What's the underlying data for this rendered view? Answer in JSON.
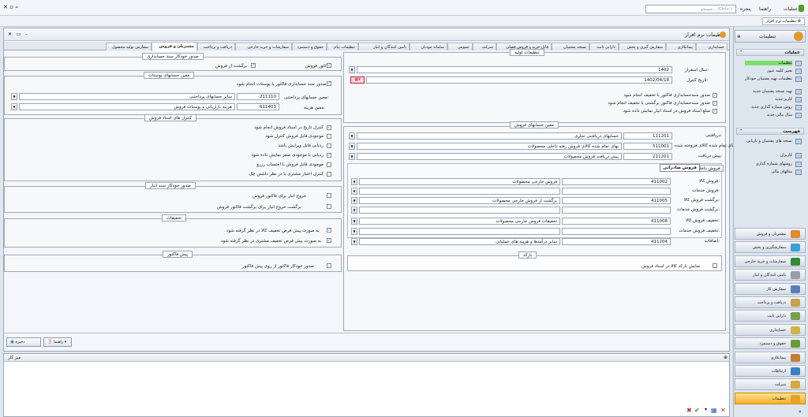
{
  "menubar": {
    "search_placeholder": "جستجو... (Ctrl+ )",
    "items": [
      "عملیات",
      "راهنما",
      "پنجره"
    ]
  },
  "breadcrumb": "تنظیمات نرم افزار",
  "window_title": "تنظیمات نرم افزار",
  "tabs": [
    "حسابداری",
    "پیمانکاری",
    "سفارش گیری و پخش",
    "دارایی ثابت",
    "نسخه پشتیبان",
    "فایل خرید و فروش فصلی",
    "شرکت",
    "عمومی",
    "سامانه مودیان",
    "تامین کنندگان و انبار",
    "تنظیمات پیام",
    "حقوق و دستمزد",
    "سفارشات و خرید خارجی",
    "دریافت و پرداخت",
    "مشتریان و فروش",
    "سفارش تولید محصول"
  ],
  "active_tab": "مشتریان و فروش",
  "initial": {
    "title": "تنظیمات اولیه",
    "fiscal_year_label": "سال اسفرار:",
    "fiscal_year": "1402",
    "control_date_label": "تاریخ کنترل:",
    "control_date": "1402/04/18",
    "checks": [
      "صدور سندحسابداری فاکتور با تخفیف انجام شود",
      "صدور سندحسابداری فاکتور برگشتی با تخفیف انجام شود",
      "مبلغ اسناد فروش در اسناد انبار نمایش داده شود"
    ]
  },
  "sales_accounts": {
    "title": "معین حسابهای فروش",
    "rows": [
      {
        "label": "دریافتنی:",
        "code": "111201",
        "name": "حسابهای دریافتنی تجاری"
      },
      {
        "label": "بهای تمام شده کالای فروخته شده:",
        "code": "511001",
        "name": "بهای تمام شده کالای فروش رفته داخلی محصولات"
      },
      {
        "label": "پیش دریافت:",
        "code": "211201",
        "name": "پیش دریافت فروش محصولات"
      }
    ]
  },
  "subtabs": [
    "فروش صادراتی",
    "فروش داخلی"
  ],
  "export_sales": {
    "rows": [
      {
        "label": "فروش کالا:",
        "code": "411002",
        "name": "فروش خارجی محصولات"
      },
      {
        "label": "فروش خدمات:",
        "code": "",
        "name": ""
      },
      {
        "label": "برگشت فروش کالا:",
        "code": "411005",
        "name": "برگشت از فروش خارجی محصولات"
      },
      {
        "label": "برگشت فروش خدمات:",
        "code": "",
        "name": ""
      },
      {
        "label": "تخفیف فروش کالا:",
        "code": "411008",
        "name": "تخفیفات فروش خارجی محصولات"
      },
      {
        "label": "تخفیف فروش خدمات:",
        "code": "",
        "name": ""
      },
      {
        "label": "اضافات:",
        "code": "411204",
        "name": "سایر درآمدها و هزینه های عملیاتی"
      }
    ]
  },
  "barcode": {
    "title": "بارکد",
    "check": "نمایش بارکد کالا در اسناد فروش"
  },
  "auto_voucher": {
    "title": "صدور خودکار سند حسابداری",
    "c1": "فاکتور فروش",
    "c2": "برگشت از فروش"
  },
  "receivables": {
    "title": "معین حسابهای پوستات",
    "check": "صدور سند حسابداری فاکتور با پوستات انجام شود",
    "r1_label": "معین حسابهای پرداختنی:",
    "r1_code": "211110",
    "r1_name": "سایر حسابهای پرداختنی",
    "r2_label": "معین هزینه:",
    "r2_code": "611403",
    "r2_name": "هزینه بازاریابی و پوستات فروش"
  },
  "controls": {
    "title": "کنترل های اسناد فروش",
    "checks": [
      {
        "text": "کنترل تاریخ در اسناد فروش انجام شود",
        "checked": true
      },
      {
        "text": "موجودی قابل فروش کنترل شود",
        "checked": false
      },
      {
        "text": "ردیابی قابل ویرایش باشد",
        "checked": false
      },
      {
        "text": "ردیابی با موجودی صفر نمایش داده شود",
        "checked": true
      },
      {
        "text": "موجودی قابل فروش با احتساب رزرو",
        "checked": false
      },
      {
        "text": "کنترل اعتبار مشتری با در نظر داشتن چک",
        "checked": false
      }
    ]
  },
  "warehouse": {
    "title": "صدور خودکار سند انبار",
    "c1": "خروج انبار برای فاکتور فروش",
    "c2": "برگشت خروج انبار برای برگشت فاکتور فروش"
  },
  "discounts": {
    "title": "تخفیفات",
    "c1": "به صورت پیش فرض تخفیف کالا در نظر گرفته شود",
    "c2": "به صورت پیش فرض تخفیف مشتری در نظر گرفته شود"
  },
  "proforma": {
    "title": "پیش فاکتور",
    "c1": "صدور خودکار فاکتور از روی پیش فاکتور"
  },
  "footer": {
    "save": "ذخیره",
    "help": "راهنما"
  },
  "bottom_title": "میز کار",
  "rightpanel": {
    "title": "تنظیمات",
    "sec1": "عملیات",
    "ops": [
      "تنظیمات",
      "تغییر کلمه عبور",
      "تنظیمات تهیه پشتیبان خودکار",
      "تهیه نسخه پشتیبان جدید",
      "کاربر جدید",
      "روش شماره گذاری جدید",
      "سال مالی جدید"
    ],
    "sec2": "فهرست",
    "lists": [
      "نسخه های پشتیبان و بازیابی",
      "کاربران",
      "روشهای شماره گذاری",
      "سالهای مالی"
    ],
    "nav": [
      "مشتریان و فروش",
      "سفارشگیری و پخش",
      "سفارشات و خرید خارجی",
      "تامین کنندگان و انبار",
      "سفارش کار",
      "دریافت و پرداخت",
      "دارایی ثابت",
      "حسابداری",
      "حقوق و دستمزد",
      "پیمانکاری",
      "ارتباطات",
      "شرکت",
      "تنظیمات"
    ],
    "nav_colors": [
      "#e08a2c",
      "#3aa0d8",
      "#2f8c3a",
      "#9a9aa8",
      "#5a7fb8",
      "#c7a24a",
      "#7a9c4e",
      "#d4b24a",
      "#6a9a3a",
      "#c57d32",
      "#3d7fc7",
      "#d7aa3a",
      "#e3a12c"
    ]
  }
}
